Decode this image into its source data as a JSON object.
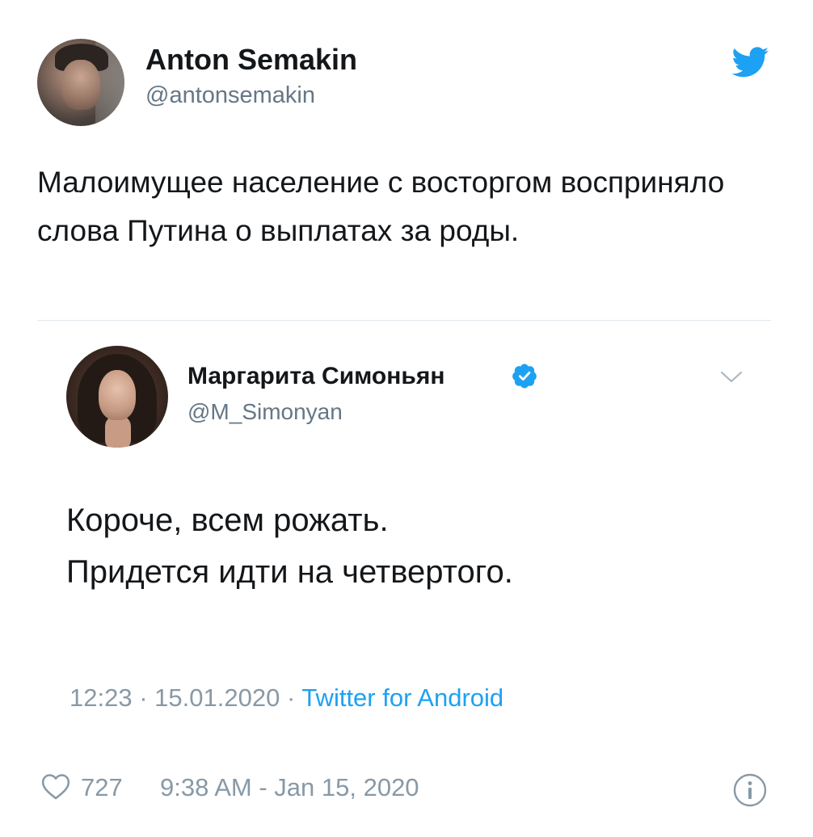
{
  "tweet": {
    "author_name": "Anton Semakin",
    "author_handle": "@antonsemakin",
    "text": "Малоимущее население с восторгом восприняло слова Путина о выплатах за роды.",
    "icons": {
      "platform": "twitter-bird-icon",
      "like": "heart-icon",
      "info": "info-icon"
    },
    "like_count": "727",
    "timestamp": "9:38 AM - Jan 15, 2020"
  },
  "quoted_tweet": {
    "author_name": "Маргарита Симоньян",
    "author_handle": "@M_Simonyan",
    "verified": true,
    "lines": [
      "Короче, всем рожать.",
      "Придется идти на четвертого."
    ],
    "time": "12:23",
    "date": "15.01.2020",
    "separator": "·",
    "source": "Twitter for Android",
    "icons": {
      "verified": "verified-badge-icon",
      "menu": "chevron-down-icon"
    }
  },
  "colors": {
    "twitter_blue": "#1da1f2",
    "text": "#14171a",
    "secondary_text": "#657786",
    "meta_text": "#8899a6",
    "divider": "#e1e8ed"
  }
}
